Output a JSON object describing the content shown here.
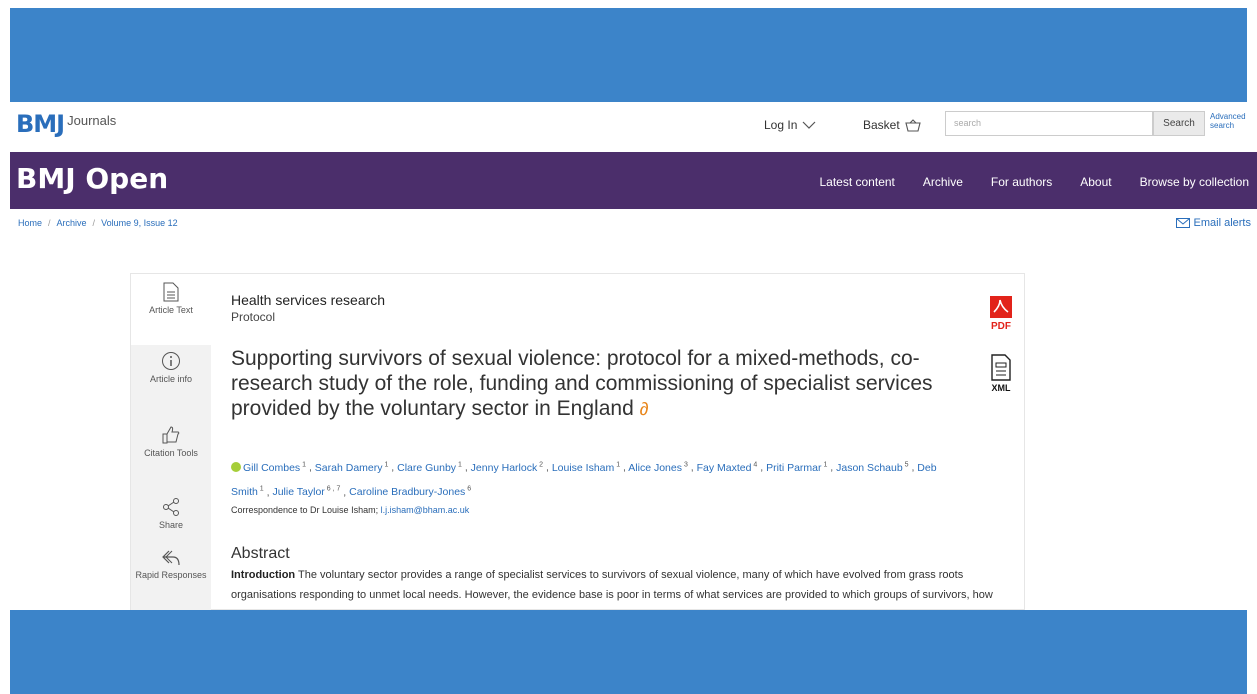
{
  "brand": {
    "logo_bmj": "BMJ",
    "logo_journals": "Journals",
    "accent": "#2a6ebb",
    "nav_bg": "#4b2e6b",
    "band_color": "#3c84c9"
  },
  "utility": {
    "login_label": "Log In",
    "basket_label": "Basket",
    "search_placeholder": "search",
    "search_button": "Search",
    "advanced_search": "Advanced search"
  },
  "nav": {
    "journal_title": "BMJ Open",
    "links": [
      "Latest content",
      "Archive",
      "For authors",
      "About",
      "Browse by collection"
    ]
  },
  "breadcrumb": [
    "Home",
    "Archive",
    "Volume 9, Issue 12"
  ],
  "email_alerts": "Email alerts",
  "sidebar": [
    {
      "label": "Article Text",
      "icon": "document-icon"
    },
    {
      "label": "Article info",
      "icon": "info-icon"
    },
    {
      "label": "Citation Tools",
      "icon": "thumbs-up-icon"
    },
    {
      "label": "Share",
      "icon": "share-icon"
    },
    {
      "label": "Rapid Responses",
      "icon": "reply-icon"
    }
  ],
  "article": {
    "section": "Health services research",
    "subsection": "Protocol",
    "title": "Supporting survivors of sexual violence: protocol for a mixed-methods, co-research study of the role, funding and commissioning of specialist services provided by the voluntary sector in England",
    "authors": [
      {
        "name": "Gill Combes",
        "sup": "1",
        "orcid": true
      },
      {
        "name": "Sarah Damery",
        "sup": "1"
      },
      {
        "name": "Clare Gunby",
        "sup": "1"
      },
      {
        "name": "Jenny Harlock",
        "sup": "2"
      },
      {
        "name": "Louise Isham",
        "sup": "1"
      },
      {
        "name": "Alice Jones",
        "sup": "3"
      },
      {
        "name": "Fay Maxted",
        "sup": "4"
      },
      {
        "name": "Priti Parmar",
        "sup": "1"
      },
      {
        "name": "Jason Schaub",
        "sup": "5"
      },
      {
        "name": "Deb Smith",
        "sup": "1"
      },
      {
        "name": "Julie Taylor",
        "sup": "6 , 7"
      },
      {
        "name": "Caroline Bradbury-Jones",
        "sup": "6"
      }
    ],
    "correspondence_prefix": "Correspondence to Dr Louise Isham;",
    "correspondence_email": "l.j.isham@bham.ac.uk",
    "abstract_heading": "Abstract",
    "abstract_label": "Introduction",
    "abstract_text": "The voluntary sector provides a range of specialist services to survivors of sexual violence, many of which have evolved from grass roots organisations responding to unmet local needs. However, the evidence base is poor in terms of what services are provided to which groups of survivors, how voluntary sector specialist (VSS) services are organised and delivered and",
    "pdf_label": "PDF",
    "xml_label": "XML"
  }
}
